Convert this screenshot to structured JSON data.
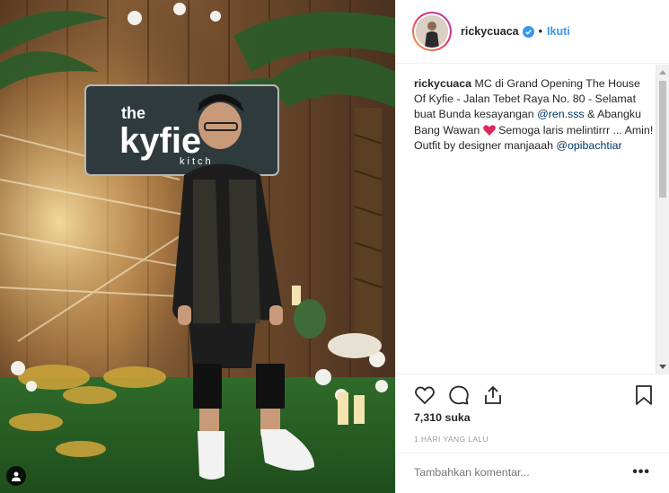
{
  "post": {
    "username": "rickycuaca",
    "follow_label": "Ikuti",
    "caption": {
      "username": "rickycuaca",
      "text_part1": "MC di Grand Opening The House Of Kyfie - Jalan Tebet Raya No. 80 - Selamat buat Bunda kesayangan ",
      "mention1": "@ren.sss",
      "text_part2": " & Abangku Bang Wawan ",
      "text_part3": " Semoga laris melintirrr ... Amin! Outfit by designer manjaaah ",
      "mention2": "@opibachtiar"
    },
    "likes": "7,310 suka",
    "timestamp": "1 HARI YANG LALU",
    "comment_placeholder": "Tambahkan komentar...",
    "more_label": "•••"
  },
  "photo": {
    "sign_line1": "the",
    "sign_line2": "kyfie",
    "sign_line3": "kitch"
  },
  "colors": {
    "accent": "#3897f0",
    "mention": "#003569",
    "heart": "#e0245e",
    "ring_start": "#f9a33a",
    "ring_end": "#a93fb7"
  },
  "icons": [
    "tag-user-icon",
    "verified-badge-icon",
    "heart-icon",
    "comment-icon",
    "share-icon",
    "bookmark-icon",
    "red-heart-emoji-icon"
  ]
}
